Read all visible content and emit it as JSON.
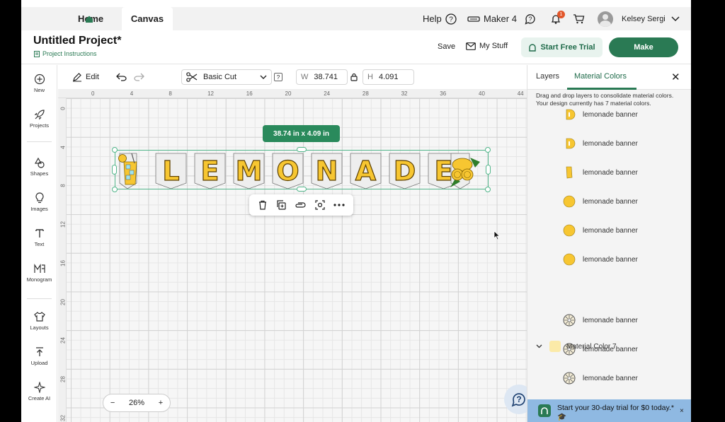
{
  "topbar": {
    "home_label": "Home",
    "canvas_label": "Canvas",
    "help_label": "Help",
    "machine_label": "Maker 4",
    "notification_count": "1",
    "user_name": "Kelsey Sergi"
  },
  "header": {
    "project_title": "Untitled Project*",
    "project_instructions": "Project Instructions",
    "save_label": "Save",
    "mystuff_label": "My Stuff",
    "trial_label": "Start Free Trial",
    "make_label": "Make"
  },
  "sidebar": {
    "items": [
      {
        "label": "New",
        "icon": "plus-circle-icon"
      },
      {
        "label": "Projects",
        "icon": "rocket-icon"
      },
      {
        "label": "Shapes",
        "icon": "shapes-icon"
      },
      {
        "label": "Images",
        "icon": "bulb-icon"
      },
      {
        "label": "Text",
        "icon": "text-icon"
      },
      {
        "label": "Monogram",
        "icon": "monogram-icon"
      },
      {
        "label": "Layouts",
        "icon": "shirt-icon"
      },
      {
        "label": "Upload",
        "icon": "upload-icon"
      },
      {
        "label": "Create AI",
        "icon": "sparkle-icon"
      }
    ]
  },
  "toolbar": {
    "edit_label": "Edit",
    "operation_label": "Basic Cut",
    "operation_help": "?",
    "width_label": "W",
    "width_value": "38.741",
    "height_label": "H",
    "height_value": "4.091"
  },
  "canvas": {
    "ruler_top": [
      "0",
      "4",
      "8",
      "12",
      "16",
      "20",
      "24",
      "28",
      "32",
      "36",
      "40",
      "44"
    ],
    "ruler_left": [
      "0",
      "4",
      "8",
      "12",
      "16",
      "20",
      "24",
      "28",
      "32"
    ],
    "dimension_badge": "38.74  in x 4.09  in",
    "banner_letters": [
      "L",
      "E",
      "M",
      "O",
      "N",
      "A",
      "D",
      "E"
    ],
    "zoom_minus": "−",
    "zoom_value": "26%",
    "zoom_plus": "+",
    "help_fab": "?"
  },
  "panel": {
    "tab_layers": "Layers",
    "tab_material": "Material Colors",
    "close": "✕",
    "description": "Drag and drop layers to consolidate material colors. Your design currently has 7 material colors.",
    "layer_name": "lemonade banner",
    "group_label": "Material Color 7",
    "trial_text": "Start your 30-day trial for $0 today.* 🎓",
    "trial_close": "×"
  },
  "colors": {
    "accent": "#2a7a54",
    "lemon": "#f7c631",
    "pale_yellow": "#fbeaa8",
    "selection": "#52b58a"
  }
}
